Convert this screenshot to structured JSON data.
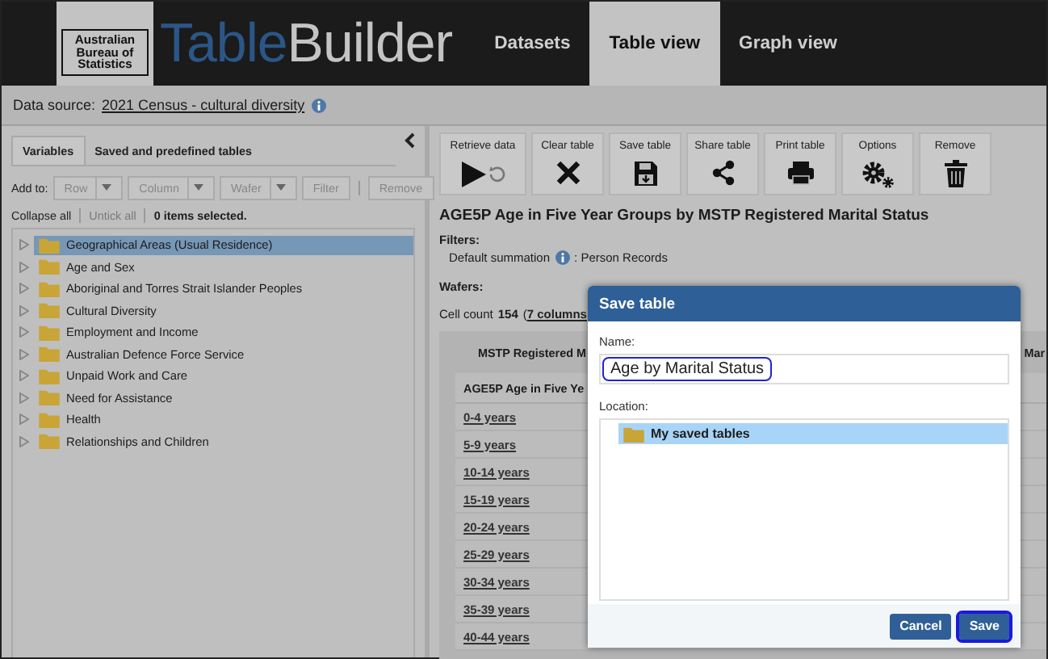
{
  "header": {
    "logo_text": "Australian Bureau of Statistics",
    "app_name_part1": "Table",
    "app_name_part2": "Builder",
    "nav": [
      {
        "label": "Datasets",
        "selected": false
      },
      {
        "label": "Table view",
        "selected": true
      },
      {
        "label": "Graph view",
        "selected": false
      }
    ]
  },
  "data_source": {
    "label": "Data source:",
    "value": "2021 Census - cultural diversity"
  },
  "left_panel": {
    "tabs": [
      {
        "label": "Variables",
        "selected": true
      },
      {
        "label": "Saved and predefined tables",
        "selected": false
      }
    ],
    "add_to": {
      "label": "Add to:",
      "controls": [
        {
          "kind": "dropdown",
          "label": "Row",
          "disabled": true
        },
        {
          "kind": "dropdown",
          "label": "Column",
          "disabled": true
        },
        {
          "kind": "dropdown",
          "label": "Wafer",
          "disabled": true
        },
        {
          "kind": "button",
          "label": "Filter",
          "disabled": true
        },
        {
          "kind": "button",
          "label": "Remove",
          "disabled": true
        }
      ]
    },
    "links": [
      {
        "label": "Collapse all",
        "disabled": false
      },
      {
        "label": "Untick all",
        "disabled": true
      }
    ],
    "selection_status": "0 items selected.",
    "tree": [
      {
        "label": "Geographical Areas (Usual Residence)",
        "selected": true,
        "expanded": false
      },
      {
        "label": "Age and Sex",
        "selected": false,
        "expanded": false
      },
      {
        "label": "Aboriginal and Torres Strait Islander Peoples",
        "selected": false,
        "expanded": false
      },
      {
        "label": "Cultural Diversity",
        "selected": false,
        "expanded": false
      },
      {
        "label": "Employment and Income",
        "selected": false,
        "expanded": false
      },
      {
        "label": "Australian Defence Force Service",
        "selected": false,
        "expanded": false
      },
      {
        "label": "Unpaid Work and Care",
        "selected": false,
        "expanded": false
      },
      {
        "label": "Need for Assistance",
        "selected": false,
        "expanded": false
      },
      {
        "label": "Health",
        "selected": false,
        "expanded": false
      },
      {
        "label": "Relationships and Children",
        "selected": false,
        "expanded": false
      }
    ]
  },
  "toolbar": [
    {
      "kind": "retrieve",
      "label": "Retrieve data"
    },
    {
      "kind": "clear",
      "label": "Clear table"
    },
    {
      "kind": "save",
      "label": "Save table"
    },
    {
      "kind": "share",
      "label": "Share table"
    },
    {
      "kind": "print",
      "label": "Print table"
    },
    {
      "kind": "options",
      "label": "Options"
    },
    {
      "kind": "remove",
      "label": "Remove"
    }
  ],
  "table_title": "AGE5P Age in Five Year Groups by MSTP Registered Marital Status",
  "filters": {
    "label": "Filters:",
    "name": "Default summation",
    "value": ": Person Records"
  },
  "wafers_label": "Wafers:",
  "cell_count": {
    "label": "Cell count",
    "value": "154",
    "prefix": "(",
    "link": "7 columns"
  },
  "table": {
    "column_header": "MSTP Registered M",
    "column_header_2": "Mar",
    "row_header": "AGE5P Age in Five Ye",
    "rows": [
      "0-4 years",
      "5-9 years",
      "10-14 years",
      "15-19 years",
      "20-24 years",
      "25-29 years",
      "30-34 years",
      "35-39 years",
      "40-44 years"
    ]
  },
  "dialog": {
    "title": "Save table",
    "name_label": "Name:",
    "name_value": "Age by Marital Status",
    "location_label": "Location:",
    "locations": [
      {
        "label": "My saved tables",
        "selected": true
      }
    ],
    "buttons": [
      {
        "label": "Cancel",
        "focused": false
      },
      {
        "label": "Save",
        "focused": true
      }
    ]
  }
}
